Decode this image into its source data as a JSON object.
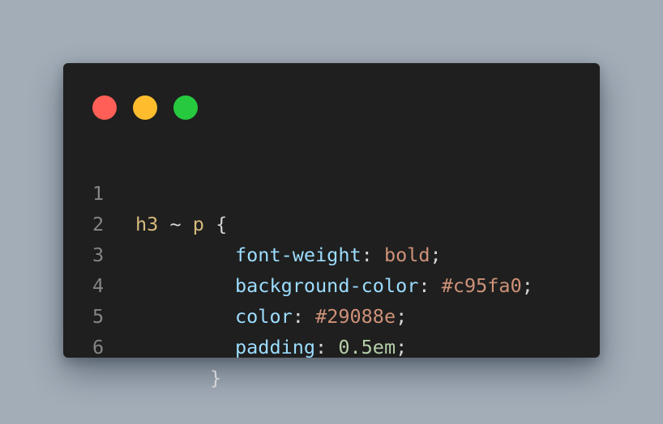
{
  "window_controls": {
    "close_color": "#ff5f56",
    "minimize_color": "#ffbd2e",
    "zoom_color": "#27c93f"
  },
  "code": {
    "lines": [
      {
        "number": "1",
        "selector": "h3",
        "combinator": "~",
        "element": "p",
        "brace_open": "{"
      },
      {
        "number": "2",
        "property": "font-weight",
        "colon": ":",
        "value": "bold",
        "semicolon": ";"
      },
      {
        "number": "3",
        "property": "background-color",
        "colon": ":",
        "value": "#c95fa0",
        "semicolon": ";"
      },
      {
        "number": "4",
        "property": "color",
        "colon": ":",
        "value": "#29088e",
        "semicolon": ";"
      },
      {
        "number": "5",
        "property": "padding",
        "colon": ":",
        "value": "0.5em",
        "semicolon": ";"
      },
      {
        "number": "6",
        "brace_close": "}"
      }
    ]
  }
}
